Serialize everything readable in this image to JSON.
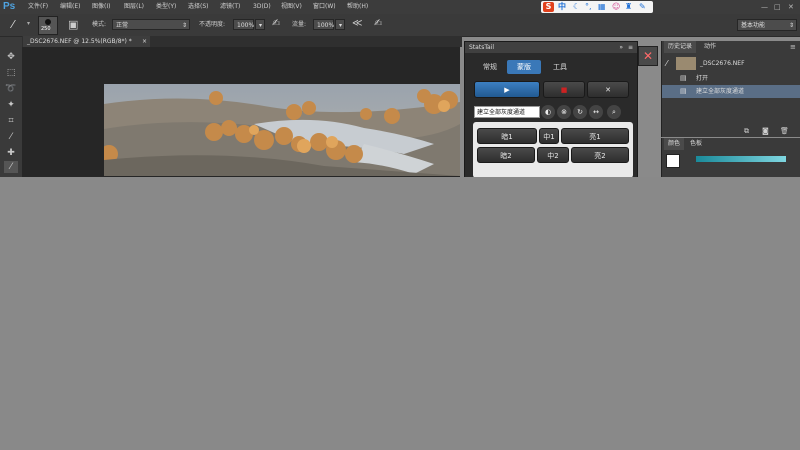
{
  "app": {
    "logo": "Ps"
  },
  "menu": [
    "文件(F)",
    "编辑(E)",
    "图像(I)",
    "图层(L)",
    "类型(Y)",
    "选择(S)",
    "滤镜(T)",
    "3D(D)",
    "视图(V)",
    "窗口(W)",
    "帮助(H)"
  ],
  "ime": {
    "logo": "S",
    "lang": "中"
  },
  "window_controls": {
    "minimize": "—",
    "maximize": "□",
    "close": "✕"
  },
  "options": {
    "brush_size": "250",
    "mode_label": "模式:",
    "mode_value": "正常",
    "opacity_label": "不透明度:",
    "opacity_value": "100%",
    "flow_label": "流量:",
    "flow_value": "100%",
    "workspace": "基本功能"
  },
  "document": {
    "tab_title": "_DSC2676.NEF @ 12.5%(RGB/8*) *",
    "tab_close": "×"
  },
  "stats_panel": {
    "title": "StatsTail",
    "tabs": [
      "常规",
      "蒙版",
      "工具"
    ],
    "active_tab": 1,
    "play_btn": "▶",
    "stop_btn": "■",
    "close_btn": "✕",
    "dropdown_value": "建立全部灰度通道",
    "grid_row1": [
      "暗1",
      "中1",
      "亮1"
    ],
    "grid_row2": [
      "暗2",
      "中2",
      "亮2"
    ]
  },
  "history_panel": {
    "tabs": [
      "历史记录",
      "动作"
    ],
    "snapshot_name": "_DSC2676.NEF",
    "items": [
      "打开",
      "建立全部灰度通道"
    ]
  },
  "color_panel": {
    "tabs": [
      "颜色",
      "色板"
    ]
  },
  "colors": {
    "accent": "#3a78b8",
    "chrome": "#3a3a3a",
    "workspace_gray": "#898989"
  }
}
